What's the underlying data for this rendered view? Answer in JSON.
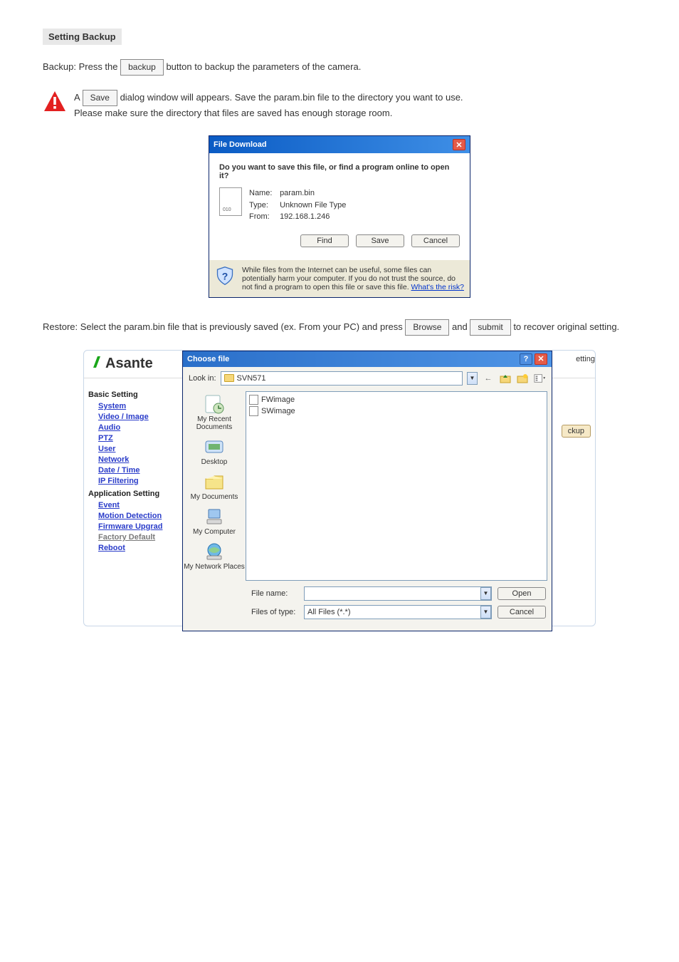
{
  "doc": {
    "heading": "Setting Backup",
    "para1_a": "Backup: Press the ",
    "para1_btn": "backup",
    "para1_b": " button to backup the parameters of the camera.",
    "warn_line1_a": " A ",
    "warn_line1_btn": "Save",
    "warn_line1_b": " dialog window will appears. Save the param.bin file to the directory you want to use.",
    "warn_line2": "Please make sure the directory that files are saved has enough storage room.",
    "para2_a": "Restore: Select the param.bin file that is previously saved (ex. From your PC) and press ",
    "para2_btn_browse": "Browse",
    "para2_b": " and ",
    "para2_btn_submit": "submit",
    "para2_c": " to recover original setting."
  },
  "fileDownload": {
    "title": "File Download",
    "question": "Do you want to save this file, or find a program online to open it?",
    "nameLabel": "Name:",
    "nameValue": "param.bin",
    "typeLabel": "Type:",
    "typeValue": "Unknown File Type",
    "fromLabel": "From:",
    "fromValue": "192.168.1.246",
    "buttons": {
      "find": "Find",
      "save": "Save",
      "cancel": "Cancel"
    },
    "warning": "While files from the Internet can be useful, some files can potentially harm your computer. If you do not trust the source, do not find a program to open this file or save this file. ",
    "riskLink": "What's the risk?"
  },
  "sidebar": {
    "logo": "Asante",
    "basicHeading": "Basic Setting",
    "appHeading": "Application Setting",
    "links": {
      "system": "System",
      "videoImage": "Video / Image",
      "audio": "Audio",
      "ptz": "PTZ",
      "user": "User",
      "network": "Network",
      "dateTime": "Date / Time",
      "ipFiltering": "IP Filtering",
      "event": "Event",
      "motionDetection": "Motion Detection",
      "firmwareUpgrade": "Firmware Upgrad",
      "factoryDefault": "Factory Default",
      "reboot": "Reboot"
    },
    "peekRight": "etting",
    "peekButton": "ckup"
  },
  "choose": {
    "title": "Choose file",
    "lookInLabel": "Look in:",
    "lookInValue": "SVN571",
    "places": {
      "recent": "My Recent Documents",
      "desktop": "Desktop",
      "documents": "My Documents",
      "computer": "My Computer",
      "network": "My Network Places"
    },
    "files": [
      "FWimage",
      "SWimage"
    ],
    "fileNameLabel": "File name:",
    "fileNameValue": "",
    "filesOfTypeLabel": "Files of type:",
    "filesOfTypeValue": "All Files (*.*)",
    "buttons": {
      "open": "Open",
      "cancel": "Cancel"
    }
  }
}
